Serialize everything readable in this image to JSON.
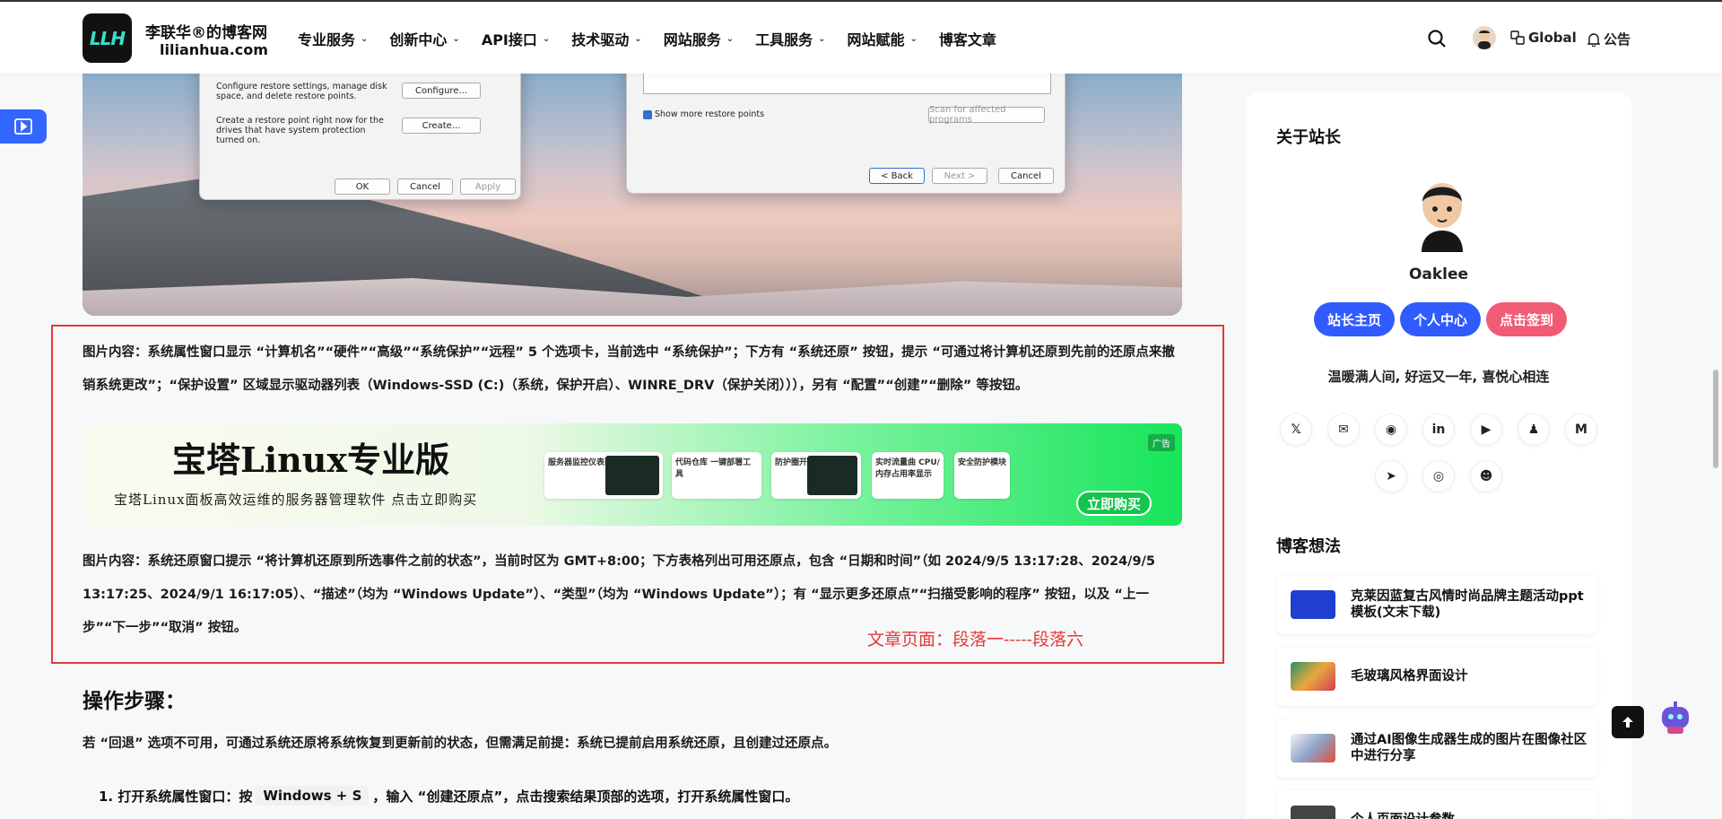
{
  "header": {
    "logo_text": "LLH",
    "site_name": "李联华®的博客网",
    "site_domain": "lilianhua.com",
    "nav": [
      {
        "label": "专业服务",
        "has_menu": true
      },
      {
        "label": "创新中心",
        "has_menu": true
      },
      {
        "label": "API接口",
        "has_menu": true
      },
      {
        "label": "技术驱动",
        "has_menu": true
      },
      {
        "label": "网站服务",
        "has_menu": true
      },
      {
        "label": "工具服务",
        "has_menu": true
      },
      {
        "label": "网站赋能",
        "has_menu": true
      },
      {
        "label": "博客文章",
        "has_menu": false
      }
    ],
    "global_label": "Global",
    "notice_label": "公告"
  },
  "hero_dialogs": {
    "left": {
      "configure_text": "Configure restore settings, manage disk space, and delete restore points.",
      "configure_btn": "Configure...",
      "create_text": "Create a restore point right now for the drives that have system protection turned on.",
      "create_btn": "Create...",
      "ok": "OK",
      "cancel": "Cancel",
      "apply": "Apply"
    },
    "right": {
      "show_more": "Show more restore points",
      "scan": "Scan for affected programs",
      "back": "< Back",
      "next": "Next >",
      "cancel": "Cancel"
    }
  },
  "article": {
    "para1": "图片内容：系统属性窗口显示 “计算机名”“硬件”“高级”“系统保护”“远程” 5 个选项卡，当前选中 “系统保护”；下方有 “系统还原” 按钮，提示 “可通过将计算机还原到先前的还原点来撤销系统更改”；“保护设置” 区域显示驱动器列表（Windows-SSD (C:)（系统，保护开启）、WINRE_DRV（保护关闭））），另有 “配置”“创建”“删除” 等按钮。",
    "para2": "图片内容：系统还原窗口提示 “将计算机还原到所选事件之前的状态”，当前时区为 GMT+8:00；下方表格列出可用还原点，包含 “日期和时间”（如 2024/9/5 13:17:28、2024/9/5 13:17:25、2024/9/1 16:17:05）、“描述”（均为 “Windows Update”）、“类型”（均为 “Windows Update”）；有 “显示更多还原点”“扫描受影响的程序” 按钮，以及 “上一步”“下一步”“取消” 按钮。",
    "annotation": "文章页面：段落一-----段落六",
    "heading": "操作步骤：",
    "intro": "若 “回退” 选项不可用，可通过系统还原将系统恢复到更新前的状态，但需满足前提：系统已提前启用系统还原，且创建过还原点。",
    "step1_prefix": "1. 打开系统属性窗口：按",
    "step1_key": "Windows + S",
    "step1_suffix": "，输入 “创建还原点”，点击搜索结果顶部的选项，打开系统属性窗口。"
  },
  "ad": {
    "title": "宝塔Linux专业版",
    "subtitle": "宝塔Linux面板高效运维的服务器管理软件  点击立即购买",
    "cards": [
      "服务器监控仪表面",
      "代码仓库  一键部署工具",
      "防护圈开关",
      "实时流量曲 CPU/内存占用率显示",
      "安全防护模块"
    ],
    "buy": "立即购买",
    "tag": "广告"
  },
  "sidebar": {
    "about_title": "关于站长",
    "name": "Oaklee",
    "buttons": [
      {
        "label": "站长主页",
        "color": "#2f5bff"
      },
      {
        "label": "个人中心",
        "color": "#2f5bff"
      },
      {
        "label": "点击签到",
        "color": "#f25b74"
      }
    ],
    "motto": "温暖满人间, 好运又一年, 喜悦心相连",
    "social": [
      "x-icon",
      "mail-icon",
      "github-icon",
      "linkedin-icon",
      "youtube-icon",
      "qq-icon",
      "medium-icon",
      "telegram-icon",
      "camera-icon",
      "group-icon"
    ],
    "blog_title": "博客想法",
    "posts": [
      {
        "title": "克莱因蓝复古风情时尚品牌主题活动ppt模板(文末下载)",
        "thumb_color": "#1f3fd0"
      },
      {
        "title": "毛玻璃风格界面设计",
        "thumb_color": "#e7a93a"
      },
      {
        "title": "通过AI图像生成器生成的图片在图像社区中进行分享",
        "thumb_color": "#8ea3c9"
      },
      {
        "title": "个人页面设计参数",
        "thumb_color": "#444444"
      }
    ]
  }
}
